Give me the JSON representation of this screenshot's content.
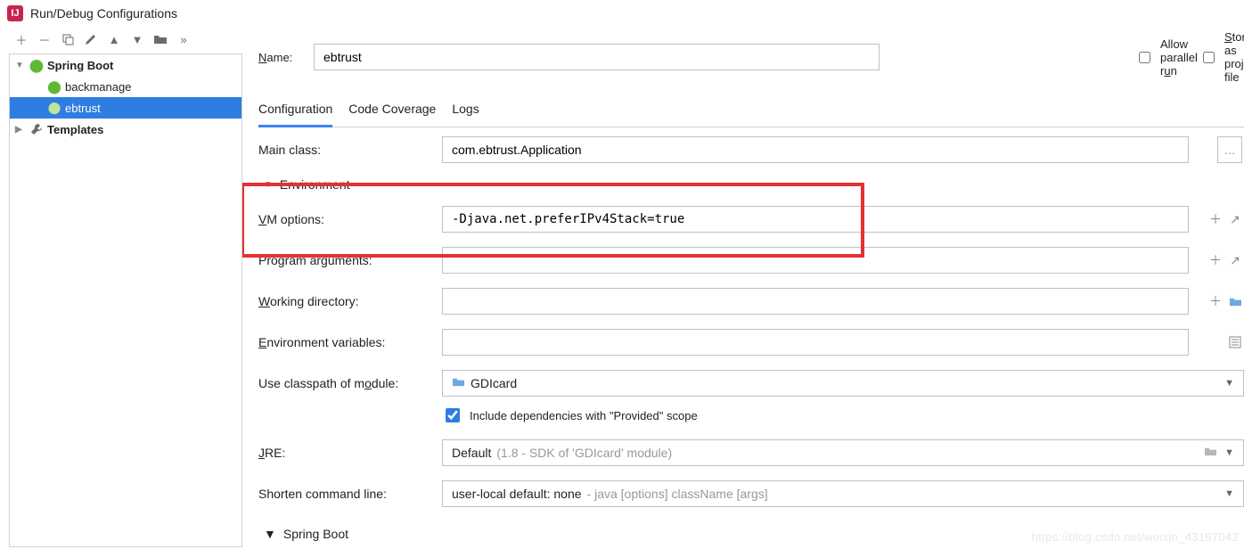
{
  "window": {
    "title": "Run/Debug Configurations"
  },
  "toolbar_icons": [
    "add",
    "remove",
    "copy",
    "wrench",
    "up",
    "down",
    "folder",
    "more"
  ],
  "tree": {
    "nodes": [
      {
        "label": "Spring Boot",
        "icon": "spring",
        "bold": true,
        "expanded": true,
        "children": [
          {
            "label": "backmanage",
            "icon": "spring"
          },
          {
            "label": "ebtrust",
            "icon": "spring",
            "selected": true
          }
        ]
      },
      {
        "label": "Templates",
        "icon": "wrench",
        "bold": true,
        "expanded": false
      }
    ]
  },
  "name": {
    "label": "Name:",
    "value": "ebtrust"
  },
  "options": {
    "allow_parallel": {
      "label": "Allow parallel run",
      "checked": false
    },
    "store_as_project": {
      "label": "Store as project file",
      "checked": false
    }
  },
  "tabs": [
    {
      "label": "Configuration",
      "active": true
    },
    {
      "label": "Code Coverage",
      "active": false
    },
    {
      "label": "Logs",
      "active": false
    }
  ],
  "form": {
    "main_class": {
      "label": "Main class:",
      "value": "com.ebtrust.Application"
    },
    "environment_section": "Environment",
    "vm_options": {
      "label": "VM options:",
      "value": "-Djava.net.preferIPv4Stack=true"
    },
    "program_args": {
      "label": "Program arguments:",
      "value": ""
    },
    "working_dir": {
      "label": "Working directory:",
      "value": ""
    },
    "env_vars": {
      "label": "Environment variables:",
      "value": ""
    },
    "classpath_module": {
      "label": "Use classpath of module:",
      "value": "GDIcard"
    },
    "include_provided": {
      "label": "Include dependencies with \"Provided\" scope",
      "checked": true
    },
    "jre": {
      "label": "JRE:",
      "value": "Default",
      "hint": "(1.8 - SDK of 'GDIcard' module)"
    },
    "shorten": {
      "label": "Shorten command line:",
      "value": "user-local default: none",
      "hint": "- java [options] className [args]"
    },
    "spring_boot_section": "Spring Boot"
  },
  "watermark": "https://blog.csdn.net/weixin_43197042"
}
